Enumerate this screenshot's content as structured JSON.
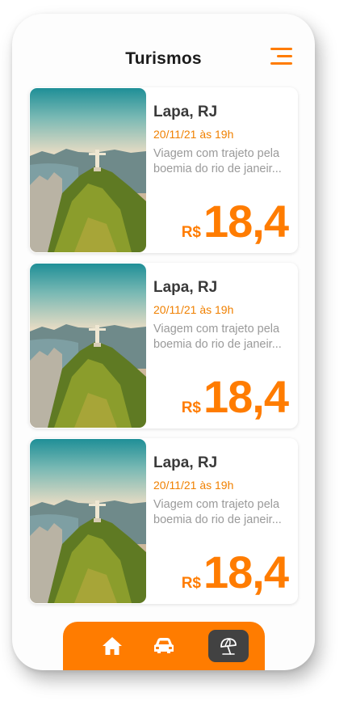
{
  "header": {
    "title": "Turismos",
    "menu_icon": "menu-icon"
  },
  "cards": [
    {
      "title": "Lapa, RJ",
      "date": "20/11/21 às 19h",
      "desc_line1": "Viagem com trajeto pela",
      "desc_line2": "boemia do rio de janeir...",
      "currency": "R$",
      "price": "18,4"
    },
    {
      "title": "Lapa, RJ",
      "date": "20/11/21 às 19h",
      "desc_line1": "Viagem com trajeto pela",
      "desc_line2": "boemia do rio de janeir...",
      "currency": "R$",
      "price": "18,4"
    },
    {
      "title": "Lapa, RJ",
      "date": "20/11/21 às 19h",
      "desc_line1": "Viagem com trajeto pela",
      "desc_line2": "boemia do rio de janeir...",
      "currency": "R$",
      "price": "18,4"
    }
  ],
  "bottom_nav": {
    "items": [
      {
        "icon": "home-icon",
        "active": false
      },
      {
        "icon": "car-icon",
        "active": false
      },
      {
        "icon": "beach-umbrella-icon",
        "active": true
      }
    ]
  },
  "colors": {
    "accent": "#ff7c00",
    "active_tab": "#424242",
    "title": "#1b1b1b",
    "muted": "#9a9a9a"
  }
}
